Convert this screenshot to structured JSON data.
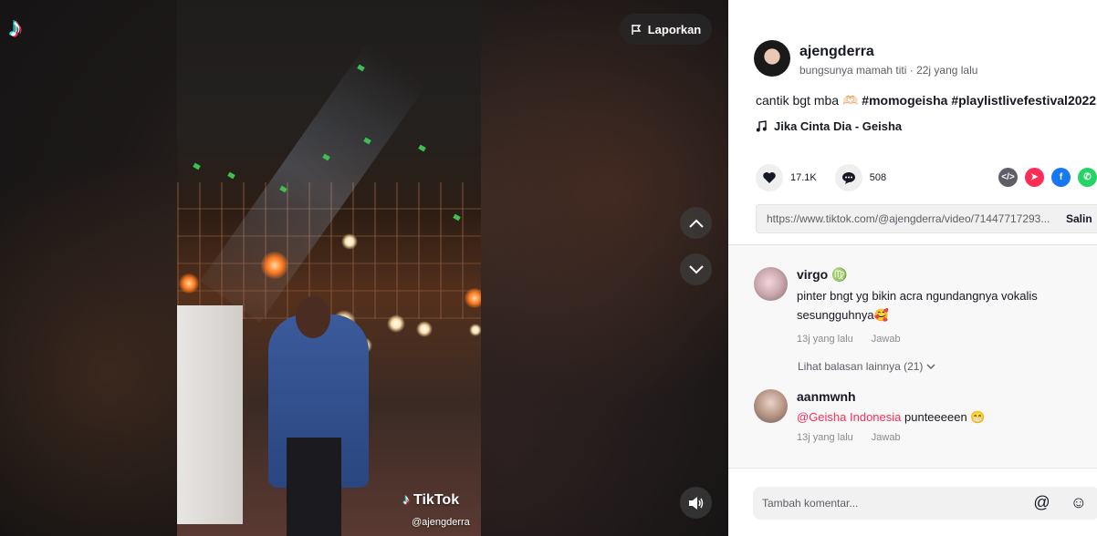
{
  "app": {
    "logo_icon": "tiktok-logo-icon"
  },
  "video": {
    "report_label": "Laporkan",
    "watermark_brand": "TikTok",
    "watermark_handle": "@ajengderra"
  },
  "author": {
    "username": "ajengderra",
    "subtitle": "bungsunya mamah titi · 22j yang lalu"
  },
  "post": {
    "caption": "cantik bgt mba",
    "caption_emoji": "🫶🏻",
    "hashtags": [
      "#momogeisha",
      "#playlistlivefestival2022"
    ],
    "music": "Jika Cinta Dia - Geisha"
  },
  "stats": {
    "likes": "17.1K",
    "comments": "508"
  },
  "share": {
    "url": "https://www.tiktok.com/@ajengderra/video/71447717293...",
    "copy_label": "Salin"
  },
  "comments": [
    {
      "name": "virgo",
      "badge": "♍",
      "text": "pinter bngt yg bikin acra ngundangnya vokalis sesungguhnya🥰",
      "time": "13j yang lalu",
      "reply_label": "Jawab",
      "more_replies": "Lihat balasan lainnya (21)"
    },
    {
      "name": "aanmwnh",
      "mention": "@Geisha Indonesia",
      "text": " punteeeeen 😁",
      "time": "13j yang lalu",
      "reply_label": "Jawab"
    }
  ],
  "comment_box": {
    "placeholder": "Tambah komentar..."
  },
  "colors": {
    "accent": "#fe2c55",
    "cyan": "#25f4ee",
    "facebook": "#1877f2",
    "whatsapp": "#25d366"
  }
}
